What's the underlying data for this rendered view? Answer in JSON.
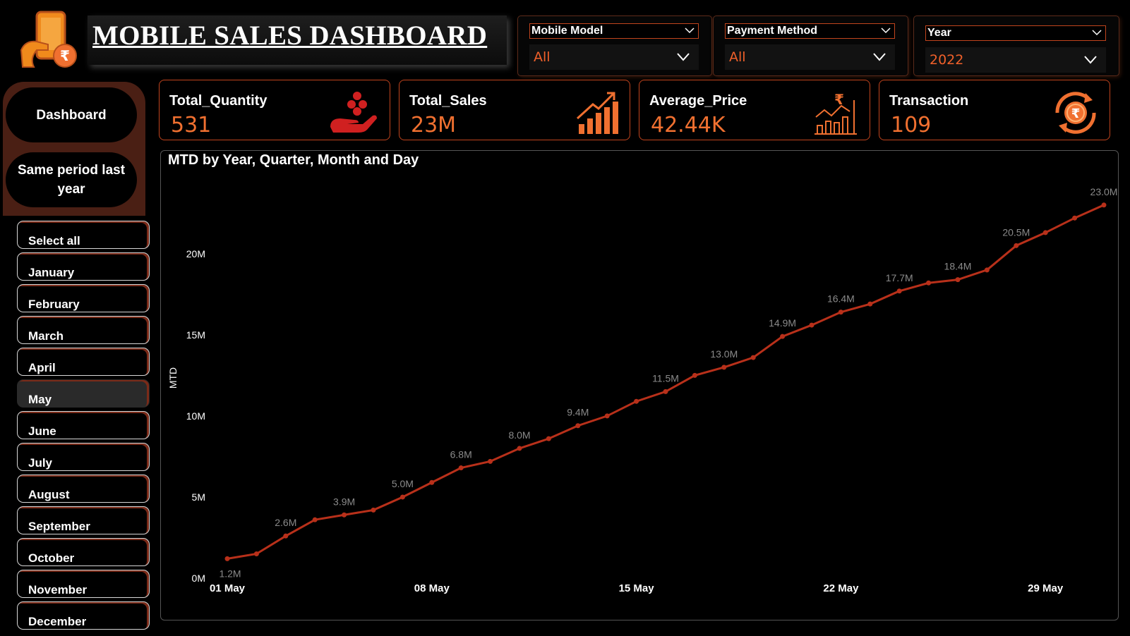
{
  "header": {
    "title": "MOBILE SALES DASHBOARD"
  },
  "filters": [
    {
      "label": "Mobile Model",
      "value": "All"
    },
    {
      "label": "Payment Method",
      "value": "All"
    },
    {
      "label": "Year",
      "value": "2022"
    }
  ],
  "nav": {
    "dashboard": "Dashboard",
    "same_period": "Same period last year"
  },
  "months": {
    "selected": "May",
    "items": [
      "Select all",
      "January",
      "February",
      "March",
      "April",
      "May",
      "June",
      "July",
      "August",
      "September",
      "October",
      "November",
      "December"
    ]
  },
  "kpis": [
    {
      "label": "Total_Quantity",
      "value": "531",
      "icon": "hand-coins-icon"
    },
    {
      "label": "Total_Sales",
      "value": "23M",
      "icon": "bar-growth-icon"
    },
    {
      "label": "Average_Price",
      "value": "42.44K",
      "icon": "rupee-chart-icon"
    },
    {
      "label": "Transaction",
      "value": "109",
      "icon": "rupee-cycle-icon"
    }
  ],
  "colors": {
    "accent": "#f07030",
    "line": "#b8301a",
    "panel": "#4a1f14"
  },
  "chart_data": {
    "type": "line",
    "title": "MTD by Year, Quarter, Month and Day",
    "xlabel": "",
    "ylabel": "MTD",
    "x": [
      "01 May",
      "02 May",
      "03 May",
      "04 May",
      "05 May",
      "06 May",
      "07 May",
      "08 May",
      "09 May",
      "10 May",
      "11 May",
      "12 May",
      "13 May",
      "14 May",
      "15 May",
      "16 May",
      "17 May",
      "18 May",
      "19 May",
      "20 May",
      "21 May",
      "22 May",
      "23 May",
      "24 May",
      "25 May",
      "26 May",
      "27 May",
      "28 May",
      "29 May",
      "30 May",
      "31 May"
    ],
    "x_ticks": [
      "01 May",
      "08 May",
      "15 May",
      "22 May",
      "29 May"
    ],
    "y_ticks": [
      "0M",
      "5M",
      "10M",
      "15M",
      "20M"
    ],
    "ylim": [
      0,
      23.6
    ],
    "series": [
      {
        "name": "",
        "values": [
          1.2,
          1.5,
          2.6,
          3.6,
          3.9,
          4.2,
          5.0,
          5.9,
          6.8,
          7.2,
          8.0,
          8.6,
          9.4,
          10.0,
          10.9,
          11.5,
          12.5,
          13.0,
          13.6,
          14.9,
          15.6,
          16.4,
          16.9,
          17.7,
          18.2,
          18.4,
          19.0,
          20.5,
          21.3,
          22.2,
          23.0
        ],
        "labels": [
          "1.2M",
          "",
          "2.6M",
          "",
          "3.9M",
          "",
          "5.0M",
          "",
          "6.8M",
          "",
          "8.0M",
          "",
          "9.4M",
          "",
          "",
          "11.5M",
          "",
          "13.0M",
          "",
          "14.9M",
          "",
          "16.4M",
          "",
          "17.7M",
          "",
          "18.4M",
          "",
          "20.5M",
          "",
          "",
          "23.0M"
        ]
      }
    ]
  }
}
